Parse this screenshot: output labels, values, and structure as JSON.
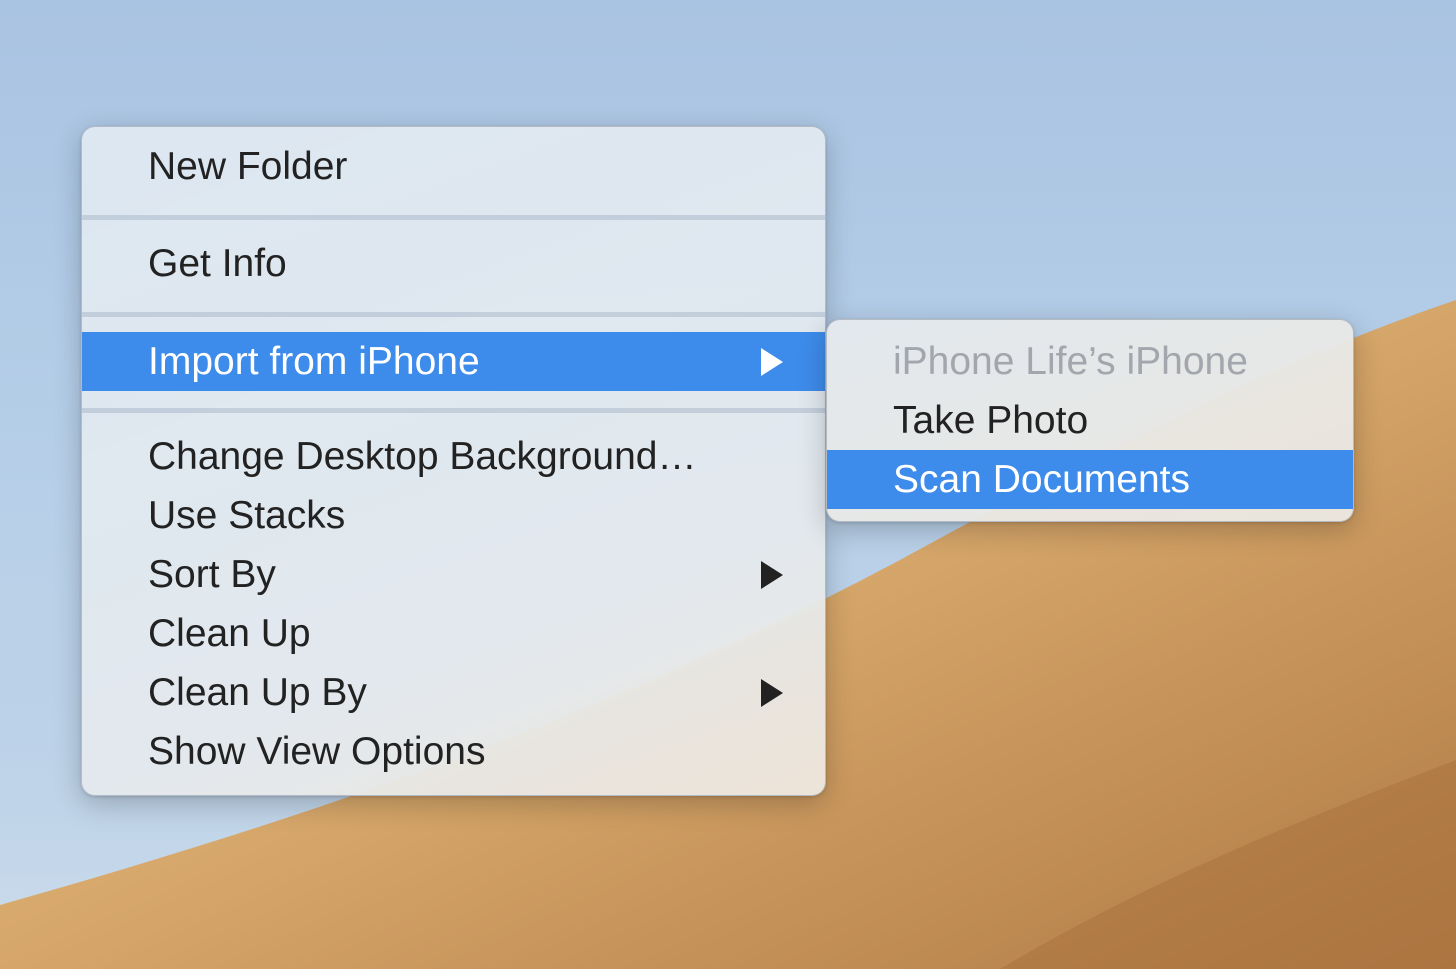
{
  "main_menu": {
    "items": [
      {
        "label": "New Folder"
      },
      {
        "label": "Get Info"
      },
      {
        "label": "Import from iPhone"
      },
      {
        "label": "Change Desktop Background…"
      },
      {
        "label": "Use Stacks"
      },
      {
        "label": "Sort By"
      },
      {
        "label": "Clean Up"
      },
      {
        "label": "Clean Up By"
      },
      {
        "label": "Show View Options"
      }
    ]
  },
  "sub_menu": {
    "items": [
      {
        "label": "iPhone Life’s iPhone"
      },
      {
        "label": "Take Photo"
      },
      {
        "label": "Scan Documents"
      }
    ]
  },
  "icons": {
    "submenu_arrow": "chevron-right-icon"
  },
  "colors": {
    "highlight": "#3d8bea",
    "text": "#222222",
    "disabled_text": "#a3a7ad"
  }
}
